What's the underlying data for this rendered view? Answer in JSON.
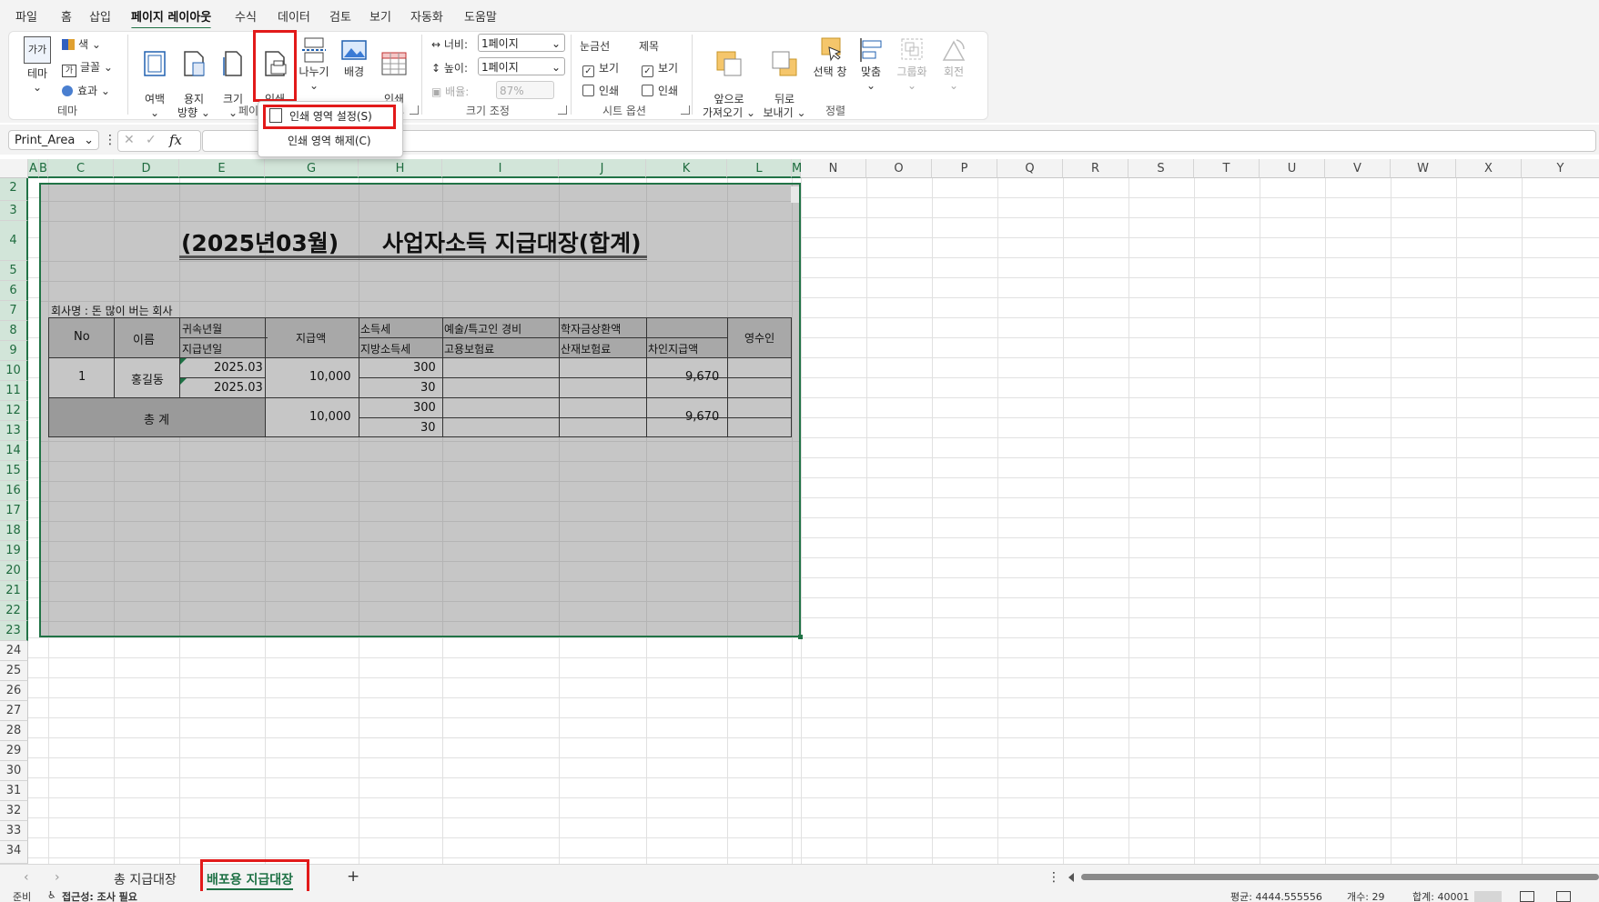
{
  "menu": {
    "tabs": [
      "파일",
      "홈",
      "삽입",
      "페이지 레이아웃",
      "수식",
      "데이터",
      "검토",
      "보기",
      "자동화",
      "도움말"
    ],
    "active": "페이지 레이아웃"
  },
  "ribbon": {
    "theme": {
      "label": "테마",
      "icon_text": "가가",
      "color": "색",
      "font": "글꼴",
      "effects": "효과",
      "group": "테마"
    },
    "page_setup": {
      "margins": "여백",
      "orientation": "용지\n방향",
      "size": "크기",
      "print_area": "인쇄\n영역",
      "breaks": "나누기",
      "background": "배경",
      "print_titles": "인쇄\n제목",
      "group": "페이"
    },
    "scale": {
      "width_label": "너비:",
      "width_value": "1페이지",
      "height_label": "높이:",
      "height_value": "1페이지",
      "scale_label": "배율:",
      "scale_value": "87%",
      "group": "크기 조정"
    },
    "sheet_options": {
      "gridlines": "눈금선",
      "headings": "제목",
      "view": "보기",
      "print": "인쇄",
      "group": "시트 옵션"
    },
    "arrange": {
      "bring_forward": "앞으로\n가져오기",
      "send_backward": "뒤로\n보내기",
      "selection_pane": "선택 창",
      "align": "맞춤",
      "group_btn": "그룹화",
      "rotate": "회전",
      "group": "정렬"
    }
  },
  "dropdown": {
    "set_print_area": "인쇄 영역 설정(S)",
    "clear_print_area": "인쇄 영역 해제(C)"
  },
  "formula": {
    "name_box": "Print_Area",
    "fx": "fx",
    "cancel": "✕",
    "enter": "✓",
    "menu": "⋮"
  },
  "columns": [
    "A",
    "B",
    "C",
    "D",
    "E",
    "G",
    "H",
    "I",
    "J",
    "K",
    "L",
    "M",
    "N",
    "O",
    "P",
    "Q",
    "R",
    "S",
    "T",
    "U",
    "V",
    "W",
    "X",
    "Y"
  ],
  "rows": [
    "2",
    "3",
    "4",
    "5",
    "6",
    "7",
    "8",
    "9",
    "10",
    "11",
    "12",
    "13",
    "14",
    "15",
    "16",
    "17",
    "18",
    "19",
    "20",
    "21",
    "22",
    "23",
    "24",
    "25",
    "26",
    "27",
    "28",
    "29",
    "30",
    "31",
    "32",
    "33",
    "34"
  ],
  "sheet": {
    "title_left": "(2025년03월)",
    "title_right": "사업자소득 지급대장(합계)",
    "company": "회사명 : 돈 많이 버는 회사",
    "headers": {
      "no": "No",
      "name": "이름",
      "period": "귀속년월",
      "paydate": "지급년일",
      "amount": "지급액",
      "income_tax": "소득세",
      "local_tax": "지방소득세",
      "art_expense": "예술/특고인 경비",
      "employment_ins": "고용보험료",
      "student_loan": "학자금상환액",
      "accident_ins": "산재보험료",
      "net_pay": "차인지급액",
      "receipt": "영수인"
    },
    "row1": {
      "no": "1",
      "name": "홍길동",
      "period": "2025.03",
      "paydate": "2025.03",
      "amount": "10,000",
      "income_tax": "300",
      "local_tax": "30",
      "net_pay": "9,670"
    },
    "total": {
      "label": "총 계",
      "amount": "10,000",
      "income_tax": "300",
      "local_tax": "30",
      "net_pay": "9,670"
    }
  },
  "tabs": {
    "sheet1": "총 지급대장",
    "sheet2": "배포용 지급대장",
    "add": "+",
    "more": "⋮"
  },
  "status": {
    "ready": "준비",
    "accessibility": "접근성: 조사 필요",
    "average": "평균: 4444.555556",
    "count": "개수: 29",
    "sum": "합계: 40001"
  }
}
